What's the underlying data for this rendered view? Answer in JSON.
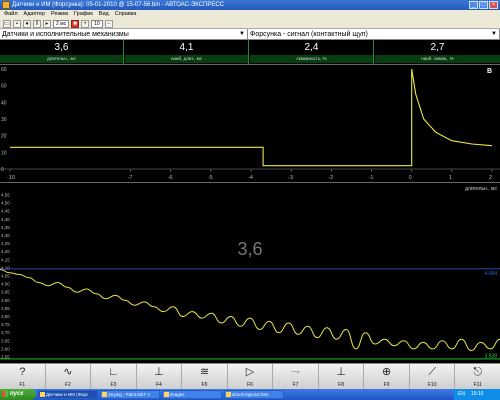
{
  "window": {
    "title": "Датчики и ИМ (Форсунка): 05-01-2010 @ 15-07-56.bin - АВТОАС-ЭКСПРЕСС",
    "controls": [
      "_",
      "□",
      "×"
    ]
  },
  "menu": [
    "Файл",
    "Адаптер",
    "Режим",
    "График",
    "Вид",
    "Справка"
  ],
  "toolbar": {
    "zoom_field": "2 мс",
    "counter_field": "10"
  },
  "selectors": {
    "left": "Датчики и исполнительные механизмы",
    "right": "Форсунка - сигнал (контактный щуп)"
  },
  "readouts": [
    {
      "value": "3,6",
      "label": "длительн., мс"
    },
    {
      "value": "4,1",
      "label": "наиб. длит., мс"
    },
    {
      "value": "2,4",
      "label": "скважность, %"
    },
    {
      "value": "2,7",
      "label": "наиб. скваж., %"
    }
  ],
  "waveform": {
    "corner_label": "В",
    "y_ticks": [
      "60",
      "50",
      "40",
      "30",
      "20",
      "10",
      "0"
    ],
    "x_ticks": [
      "-10",
      "-7",
      "-6",
      "-5",
      "-4",
      "-3",
      "-2",
      "-1",
      "0",
      "1",
      "2"
    ],
    "color": "#f0e84a"
  },
  "trend": {
    "title": "длительн., мс",
    "y_ticks": [
      "4,55",
      "4,50",
      "4,45",
      "4,40",
      "4,35",
      "4,30",
      "4,25",
      "4,20",
      "4,15",
      "4,10",
      "4,05",
      "4,00",
      "3,95",
      "3,90",
      "3,85",
      "3,80",
      "3,75",
      "3,70",
      "3,65",
      "3,60",
      "3,55"
    ],
    "current_value": "3,6",
    "max_marker": "4,094",
    "min_marker": "3,538",
    "color": "#e8e04a",
    "max_line_color": "#2a6adf",
    "min_line_color": "#2fd32f"
  },
  "chart_data": [
    {
      "type": "line",
      "title": "",
      "xlabel": "",
      "ylabel": "",
      "xlim": [
        -10,
        2
      ],
      "ylim": [
        0,
        60
      ],
      "grid": false,
      "series": [
        {
          "x": [
            -10,
            -3.7,
            -3.7,
            0,
            0,
            0.1,
            0.3,
            0.6,
            1,
            1.5,
            2
          ],
          "y": [
            13,
            13,
            2,
            2,
            60,
            45,
            30,
            22,
            17,
            15,
            14
          ]
        }
      ]
    },
    {
      "type": "line",
      "title": "длительн., мс",
      "xlabel": "",
      "ylabel": "",
      "ylim": [
        3.55,
        4.55
      ],
      "grid": false,
      "series": [
        {
          "values": [
            4.09,
            4.07,
            4.06,
            4.04,
            4.01,
            3.99,
            4.01,
            3.98,
            3.95,
            3.97,
            3.94,
            3.91,
            3.93,
            3.9,
            3.87,
            3.89,
            3.86,
            3.83,
            3.86,
            3.8,
            3.83,
            3.79,
            3.82,
            3.76,
            3.8,
            3.74,
            3.79,
            3.72,
            3.77,
            3.7,
            3.76,
            3.69,
            3.74,
            3.67,
            3.73,
            3.66,
            3.72,
            3.6,
            3.7,
            3.63,
            3.66,
            3.62,
            3.65,
            3.6,
            3.64,
            3.6,
            3.65,
            3.6,
            3.66,
            3.59,
            3.64,
            3.6,
            3.66
          ]
        }
      ]
    }
  ]
}
